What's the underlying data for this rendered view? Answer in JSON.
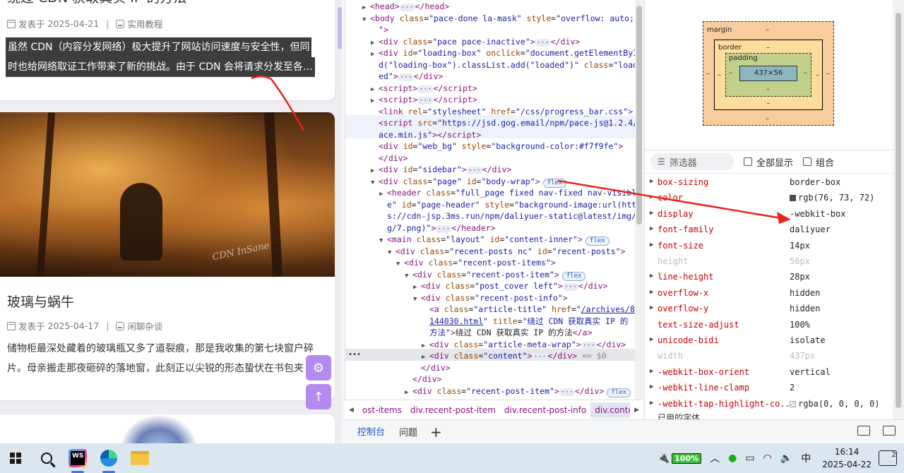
{
  "blog": {
    "post1": {
      "title": "绕过 CDN 获取真实 IP 的方法",
      "date_prefix": "发表于",
      "date": "2025-04-21",
      "category": "实用教程",
      "excerpt_line1": "虽然 CDN（内容分发网络）极大提升了网站访问速度与安全性，但同",
      "excerpt_line2": "时也给网络取证工作带来了新的挑战。由于 CDN 会将请求分发至各…"
    },
    "post2": {
      "title": "玻璃与蜗牛",
      "date_prefix": "发表于",
      "date": "2025-04-17",
      "category": "闲聊杂谈",
      "excerpt_line1": "储物柜最深处藏着的玻璃瓶又多了道裂痕，那是我收集的第七块窗户碎",
      "excerpt_line2": "片。母亲搬走那夜砸碎的落地窗，此刻正以尖锐的形态蛰伏在书包夹"
    },
    "cover_watermark": "CDN InSane",
    "fab_settings": "⚙",
    "fab_up": "↑"
  },
  "elements": {
    "lines": [
      {
        "indent": 1,
        "tri": "▶",
        "html": "<span class='tag'>&lt;head&gt;</span><span class='ell'>···</span><span class='tag'>&lt;/head&gt;</span>"
      },
      {
        "indent": 1,
        "tri": "▼",
        "html": "<span class='tag'>&lt;body</span> <span class='attr'>class</span>=<span class='val'>\"pace-done la-mask\"</span> <span class='attr'>style</span>=<span class='val'>\"overflow: auto;</span>"
      },
      {
        "indent": 2,
        "tri": "",
        "html": "<span class='val'>\"</span><span class='tag'>&gt;</span>"
      },
      {
        "indent": 2,
        "tri": "▶",
        "html": "<span class='tag'>&lt;div</span> <span class='attr'>class</span>=<span class='val'>\"pace pace-inactive\"</span><span class='tag'>&gt;</span><span class='ell'>···</span><span class='tag'>&lt;/div&gt;</span>"
      },
      {
        "indent": 2,
        "tri": "▶",
        "html": "<span class='tag'>&lt;div</span> <span class='attr'>id</span>=<span class='val'>\"loading-box\"</span> <span class='attr'>onclick</span>=<span class='val'>\"document.getElementById</span>"
      },
      {
        "indent": 2,
        "tri": "",
        "html": "<span class='val'>d(\"loading-box\").classList.add(\"loaded\")\"</span> <span class='attr'>class</span>=<span class='val'>\"load</span>"
      },
      {
        "indent": 2,
        "tri": "",
        "html": "<span class='val'>ed\"</span><span class='tag'>&gt;</span><span class='ell'>···</span><span class='tag'>&lt;/div&gt;</span>"
      },
      {
        "indent": 2,
        "tri": "▶",
        "html": "<span class='tag'>&lt;script&gt;</span><span class='ell'>···</span><span class='tag'>&lt;/script&gt;</span>"
      },
      {
        "indent": 2,
        "tri": "▶",
        "html": "<span class='tag'>&lt;script&gt;</span><span class='ell'>···</span><span class='tag'>&lt;/script&gt;</span>"
      },
      {
        "indent": 2,
        "tri": "",
        "html": "<span class='tag'>&lt;link</span> <span class='attr'>rel</span>=<span class='val'>\"stylesheet\"</span> <span class='attr'>href</span>=<span class='val'>\"/css/progress_bar.css\"</span><span class='tag'>&gt;</span>"
      },
      {
        "indent": 2,
        "tri": "",
        "html": "<span class='tag'>&lt;script</span> <span class='attr'>src</span>=<span class='val'>\"https://jsd.gog.email/npm/pace-js@1.2.4/p</span>"
      },
      {
        "indent": 2,
        "tri": "",
        "html": "<span class='val'>ace.min.js\"</span><span class='tag'>&gt;&lt;/script&gt;</span>"
      },
      {
        "indent": 2,
        "tri": "",
        "html": "<span class='tag'>&lt;div</span> <span class='attr'>id</span>=<span class='val'>\"web_bg\"</span> <span class='attr'>style</span>=<span class='val'>\"background-color:#f7f9fe\"</span><span class='tag'>&gt;</span>"
      },
      {
        "indent": 2,
        "tri": "",
        "html": "<span class='tag'>&lt;/div&gt;</span>"
      },
      {
        "indent": 2,
        "tri": "▶",
        "html": "<span class='tag'>&lt;div</span> <span class='attr'>id</span>=<span class='val'>\"sidebar\"</span><span class='tag'>&gt;</span><span class='ell'>···</span><span class='tag'>&lt;/div&gt;</span>"
      },
      {
        "indent": 2,
        "tri": "▼",
        "html": "<span class='tag'>&lt;div</span> <span class='attr'>class</span>=<span class='val'>\"page\"</span> <span class='attr'>id</span>=<span class='val'>\"body-wrap\"</span><span class='tag'>&gt;</span><span class='flex-badge'>flex</span>"
      },
      {
        "indent": 3,
        "tri": "▶",
        "html": "<span class='tag'>&lt;header</span> <span class='attr'>class</span>=<span class='val'>\"full_page fixed nav-fixed nav-visibl</span>"
      },
      {
        "indent": 3,
        "tri": "",
        "html": "<span class='val'>e\"</span> <span class='attr'>id</span>=<span class='val'>\"page-header\"</span> <span class='attr'>style</span>=<span class='val'>\"background-image:url(http</span>"
      },
      {
        "indent": 3,
        "tri": "",
        "html": "<span class='val'>s://cdn-jsp.3ms.run/npm/daliyuer-static@latest/img/b</span>"
      },
      {
        "indent": 3,
        "tri": "",
        "html": "<span class='val'>g/7.png)\"</span><span class='tag'>&gt;</span><span class='ell'>···</span><span class='tag'>&lt;/header&gt;</span>"
      },
      {
        "indent": 3,
        "tri": "▼",
        "html": "<span class='tag'>&lt;main</span> <span class='attr'>class</span>=<span class='val'>\"layout\"</span> <span class='attr'>id</span>=<span class='val'>\"content-inner\"</span><span class='tag'>&gt;</span><span class='flex-badge'>flex</span>"
      },
      {
        "indent": 4,
        "tri": "▼",
        "html": "<span class='tag'>&lt;div</span> <span class='attr'>class</span>=<span class='val'>\"recent-posts nc\"</span> <span class='attr'>id</span>=<span class='val'>\"recent-posts\"</span><span class='tag'>&gt;</span>"
      },
      {
        "indent": 5,
        "tri": "▼",
        "html": "<span class='tag'>&lt;div</span> <span class='attr'>class</span>=<span class='val'>\"recent-post-items\"</span><span class='tag'>&gt;</span>"
      },
      {
        "indent": 6,
        "tri": "▼",
        "html": "<span class='tag'>&lt;div</span> <span class='attr'>class</span>=<span class='val'>\"recent-post-item\"</span><span class='tag'>&gt;</span><span class='flex-badge'>flex</span>"
      },
      {
        "indent": 7,
        "tri": "▶",
        "html": "<span class='tag'>&lt;div</span> <span class='attr'>class</span>=<span class='val'>\"post_cover left\"</span><span class='tag'>&gt;</span><span class='ell'>···</span><span class='tag'>&lt;/div&gt;</span>"
      },
      {
        "indent": 7,
        "tri": "▼",
        "html": "<span class='tag'>&lt;div</span> <span class='attr'>class</span>=<span class='val'>\"recent-post-info\"</span><span class='tag'>&gt;</span>"
      },
      {
        "indent": 8,
        "tri": "",
        "html": "<span class='tag'>&lt;a</span> <span class='attr'>class</span>=<span class='val'>\"article-title\"</span> <span class='attr'>href</span>=<span class='val'>\"<span class='link'>/archives/89</span></span>"
      },
      {
        "indent": 8,
        "tri": "",
        "html": "<span class='link'>144030.html</span><span class='val'>\"</span> <span class='attr'>title</span>=<span class='val'>\"绕过 CDN 获取真实 IP 的</span>"
      },
      {
        "indent": 8,
        "tri": "",
        "html": "<span class='val'>方法\"</span><span class='tag'>&gt;</span><span class='txt'>绕过 CDN 获取真实 IP 的方法</span><span class='tag'>&lt;/a&gt;</span>"
      },
      {
        "indent": 8,
        "tri": "▶",
        "html": "<span class='tag'>&lt;div</span> <span class='attr'>class</span>=<span class='val'>\"article-meta-wrap\"</span><span class='tag'>&gt;</span><span class='ell'>···</span><span class='tag'>&lt;/div&gt;</span>"
      },
      {
        "indent": 8,
        "tri": "▶",
        "html": "<span class='tag'>&lt;div</span> <span class='attr'>class</span>=<span class='val'>\"content\"</span><span class='tag'>&gt;</span><span class='ell'>···</span><span class='tag'>&lt;/div&gt;</span> <span style='color:#888'>== $0</span>"
      },
      {
        "indent": 7,
        "tri": "",
        "html": "<span class='tag'>&lt;/div&gt;</span>"
      },
      {
        "indent": 6,
        "tri": "",
        "html": "<span class='tag'>&lt;/div&gt;</span>"
      },
      {
        "indent": 6,
        "tri": "▶",
        "html": "<span class='tag'>&lt;div</span> <span class='attr'>class</span>=<span class='val'>\"recent-post-item\"</span><span class='tag'>&gt;</span><span class='ell'>···</span><span class='tag'>&lt;/div&gt;</span><span class='flex-badge'>flex</span>"
      }
    ],
    "selected_index": 30,
    "gutter_dots": "•••",
    "breadcrumbs": [
      "ost-items",
      "div.recent-post-item",
      "div.recent-post-info",
      "div.content"
    ],
    "active_crumb": 3
  },
  "drawer": {
    "tab_console": "控制台",
    "tab_issues": "问题",
    "plus": "+"
  },
  "boxmodel": {
    "margin_label": "margin",
    "border_label": "border",
    "padding_label": "padding",
    "content_size": "437×56",
    "dash": "–"
  },
  "computed": {
    "filter_placeholder": "筛选器",
    "show_all_label": "全部显示",
    "group_label": "组合",
    "properties": [
      {
        "name": "box-sizing",
        "value": "border-box",
        "expandable": true,
        "dim": false
      },
      {
        "name": "color",
        "value": "rgb(76, 73, 72)",
        "expandable": true,
        "dim": false,
        "swatch": "#4c4948"
      },
      {
        "name": "display",
        "value": "-webkit-box",
        "expandable": true,
        "dim": false
      },
      {
        "name": "font-family",
        "value": "daliyuer",
        "expandable": true,
        "dim": false
      },
      {
        "name": "font-size",
        "value": "14px",
        "expandable": true,
        "dim": false
      },
      {
        "name": "height",
        "value": "56px",
        "expandable": false,
        "dim": true
      },
      {
        "name": "line-height",
        "value": "28px",
        "expandable": true,
        "dim": false
      },
      {
        "name": "overflow-x",
        "value": "hidden",
        "expandable": true,
        "dim": false
      },
      {
        "name": "overflow-y",
        "value": "hidden",
        "expandable": true,
        "dim": false
      },
      {
        "name": "text-size-adjust",
        "value": "100%",
        "expandable": false,
        "dim": false
      },
      {
        "name": "unicode-bidi",
        "value": "isolate",
        "expandable": true,
        "dim": false
      },
      {
        "name": "width",
        "value": "437px",
        "expandable": false,
        "dim": true
      },
      {
        "name": "-webkit-box-orient",
        "value": "vertical",
        "expandable": true,
        "dim": false
      },
      {
        "name": "-webkit-line-clamp",
        "value": "2",
        "expandable": true,
        "dim": false
      },
      {
        "name": "-webkit-tap-highlight-co...",
        "value": "rgba(0, 0, 0, 0)",
        "expandable": true,
        "dim": false,
        "swatch": "checker"
      }
    ],
    "cut_label": "已用的字体"
  },
  "taskbar": {
    "battery": "100%",
    "ime": "中",
    "time": "16:14",
    "date": "2025-04-22",
    "notifications": "2",
    "ws_label": "WS"
  },
  "colors": {
    "accent_blue": "#1a56c8",
    "fab_purple": "#b38bf0",
    "arrow_red": "#e8231b"
  }
}
